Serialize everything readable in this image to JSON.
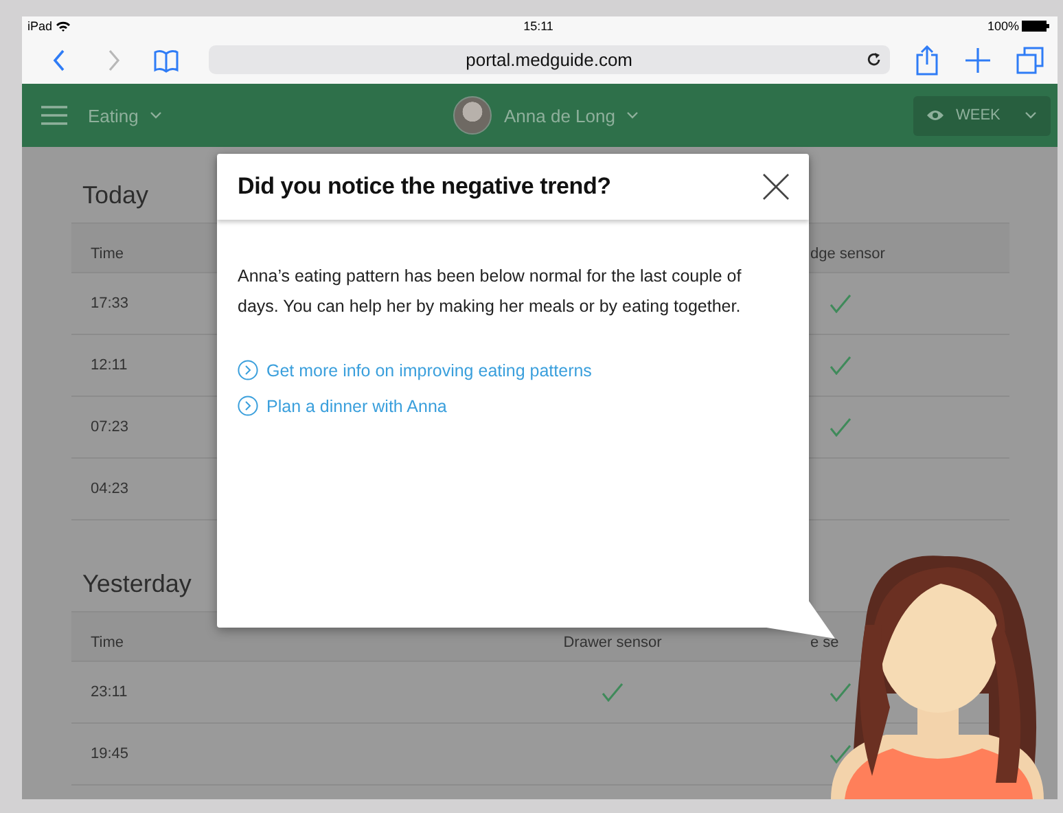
{
  "status_bar": {
    "device": "iPad",
    "time": "15:11",
    "battery": "100%"
  },
  "browser": {
    "url": "portal.medguide.com"
  },
  "app_bar": {
    "section": "Eating",
    "person": "Anna de Long",
    "period": "WEEK"
  },
  "days": [
    {
      "title": "Today",
      "headers": {
        "column_1": "Time",
        "column_3": "dge sensor"
      },
      "rows": [
        {
          "time": "17:33",
          "column_3_checked": true
        },
        {
          "time": "12:11",
          "column_3_checked": true
        },
        {
          "time": "07:23",
          "column_3_checked": true
        },
        {
          "time": "04:23",
          "column_3_checked": false
        }
      ]
    },
    {
      "title": "Yesterday",
      "headers": {
        "column_1": "Time",
        "column_2": "Drawer sensor",
        "column_3": "e se"
      },
      "rows": [
        {
          "time": "23:11",
          "column_2_checked": true,
          "column_3_checked": true
        },
        {
          "time": "19:45",
          "column_2_checked": false,
          "column_3_checked": true
        }
      ]
    }
  ],
  "dialog": {
    "title": "Did you notice the negative trend?",
    "message": "Anna’s eating pattern has been below normal for the last couple of days. You can help her by making her meals or by eating together.",
    "links": [
      "Get more info on improving eating patterns",
      "Plan a dinner with Anna"
    ]
  }
}
